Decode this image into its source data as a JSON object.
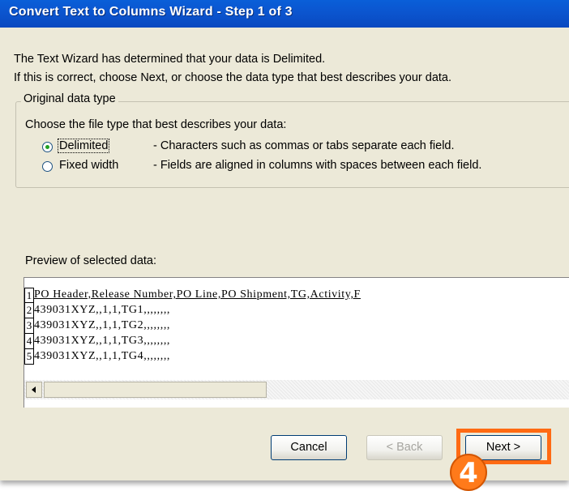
{
  "dialog": {
    "title": "Convert Text to Columns Wizard - Step 1 of 3",
    "intro_line1": "The Text Wizard has determined that your data is Delimited.",
    "intro_line2": "If this is correct, choose Next, or choose the data type that best describes your data."
  },
  "original_data_type": {
    "legend": "Original data type",
    "prompt": "Choose the file type that best describes your data:",
    "options": [
      {
        "label": "Delimited",
        "description": "- Characters such as commas or tabs separate each field.",
        "selected": true
      },
      {
        "label": "Fixed width",
        "description": "- Fields are aligned in columns with spaces between each field.",
        "selected": false
      }
    ]
  },
  "preview": {
    "label": "Preview of selected data:",
    "rows": [
      {
        "num": "1",
        "text": "PO Header,Release Number,PO Line,PO Shipment,TG,Activity,F"
      },
      {
        "num": "2",
        "text": "439031XYZ,,1,1,TG1,,,,,,,,"
      },
      {
        "num": "3",
        "text": "439031XYZ,,1,1,TG2,,,,,,,,"
      },
      {
        "num": "4",
        "text": "439031XYZ,,1,1,TG3,,,,,,,,"
      },
      {
        "num": "5",
        "text": "439031XYZ,,1,1,TG4,,,,,,,,"
      }
    ]
  },
  "buttons": {
    "cancel": "Cancel",
    "back": "< Back",
    "next": "Next >"
  },
  "annotation": {
    "step_number": "4",
    "highlight_color": "#ff6a13"
  },
  "colors": {
    "titlebar": "#0a5fd8",
    "dialog_bg": "#ece9d8"
  }
}
